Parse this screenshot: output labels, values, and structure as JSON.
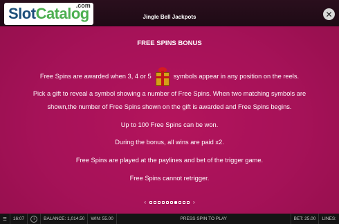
{
  "header": {
    "logo_slot": "Slot",
    "logo_catalog": "Catalog",
    "logo_dotcom": ".com",
    "game_title": "Jingle Bell Jackpots",
    "close_symbol": "✕"
  },
  "rules": {
    "heading": "FREE SPINS BONUS",
    "line1_before": "Free Spins are awarded when 3, 4 or 5",
    "line1_after": "symbols appear in any position on the reels.",
    "line2a": "Pick a gift to reveal a symbol showing a number of Free Spins. When two matching symbols are",
    "line2b": "shown,the number of Free Spins shown on the gift is awarded and Free Spins begins.",
    "line3": "Up to 100 Free Spins can be won.",
    "line4": "During the bonus, all wins are paid x2.",
    "line5": "Free Spins are played at the paylines and bet of the trigger game.",
    "line6": "Free Spins cannot retrigger.",
    "symbol_icon": "gift-icon"
  },
  "pager": {
    "prev": "‹",
    "next": "›",
    "total_pages": 10,
    "current_page": 7
  },
  "bottom_bar": {
    "time": "16:07",
    "info_symbol": "i",
    "balance": "BALANCE: 1,014.50",
    "win": "WIN: 55.00",
    "status": "PRESS SPIN TO PLAY",
    "bet": "BET: 25.00",
    "lines": "LINES:"
  }
}
